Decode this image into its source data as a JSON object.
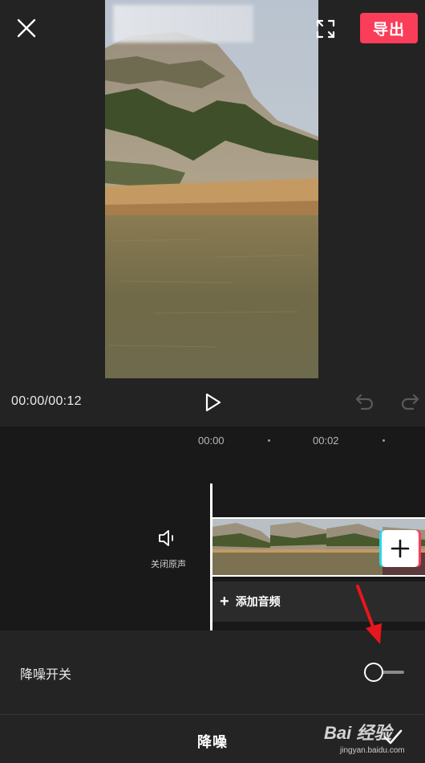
{
  "header": {
    "export_label": "导出",
    "close_icon": "close-icon",
    "fullscreen_icon": "fullscreen-icon"
  },
  "player": {
    "timecode": "00:00/00:12",
    "play_icon": "play-icon",
    "undo_icon": "undo-icon",
    "redo_icon": "redo-icon"
  },
  "timeline": {
    "ruler": [
      "00:00",
      "00:02"
    ],
    "mute_label": "关闭原声",
    "add_audio_label": "添加音频"
  },
  "panel": {
    "denoise_switch_label": "降噪开关",
    "denoise_enabled": false,
    "title": "降噪"
  },
  "watermark": {
    "brand": "Bai 经验",
    "domain": "jingyan.baidu.com"
  },
  "colors": {
    "accent": "#fa3d59",
    "background": "#232323",
    "timeline_bg": "#191919"
  }
}
